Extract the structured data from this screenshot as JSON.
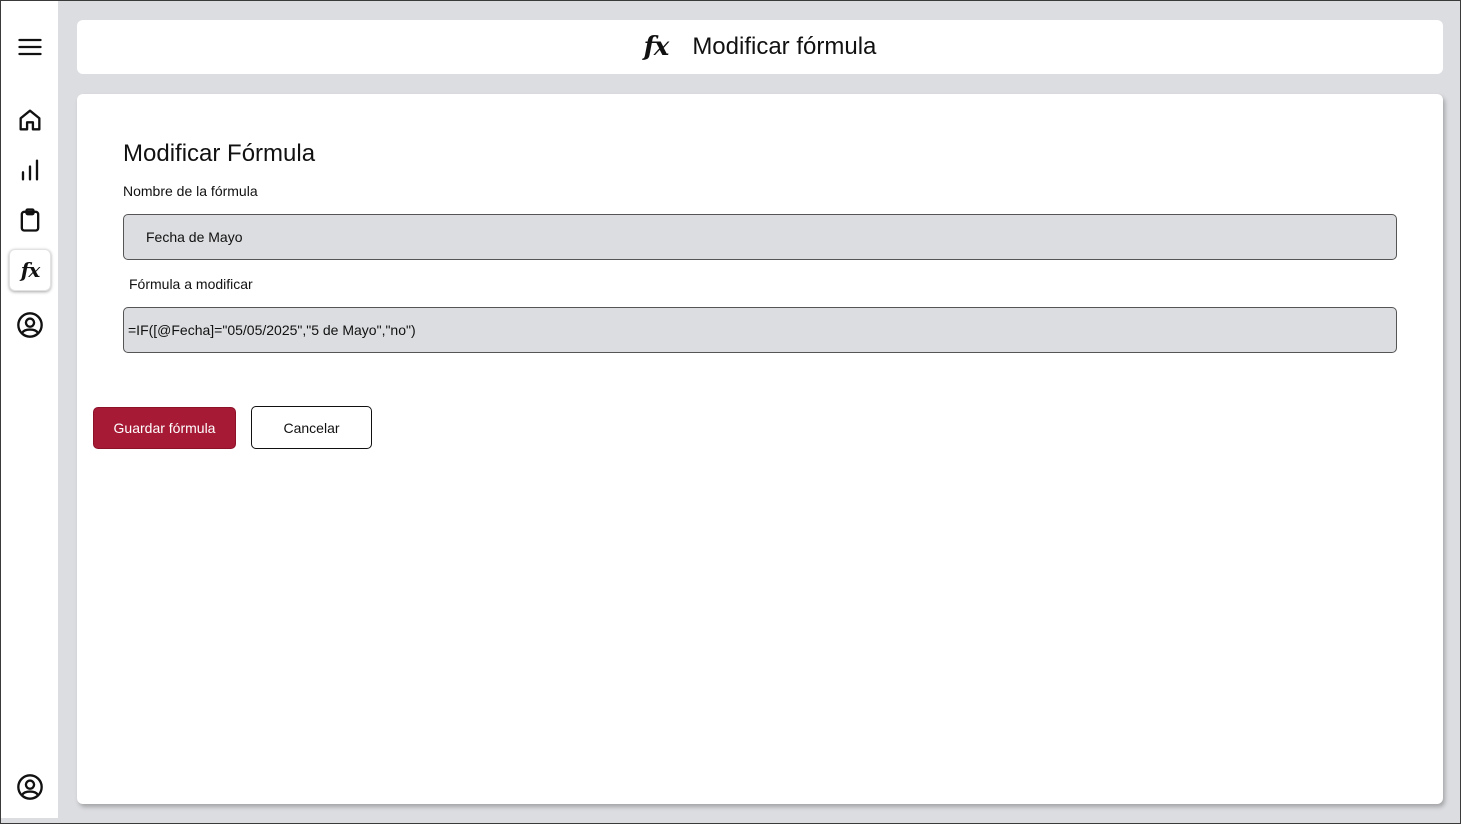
{
  "sidebar": {
    "items": [
      {
        "icon": "menu-icon"
      },
      {
        "icon": "home-icon"
      },
      {
        "icon": "bar-chart-icon"
      },
      {
        "icon": "clipboard-icon"
      },
      {
        "icon": "fx-icon",
        "glyph": "fx",
        "active": true
      },
      {
        "icon": "user-circle-icon"
      },
      {
        "icon": "profile-icon"
      }
    ]
  },
  "header": {
    "icon_glyph": "fx",
    "title": "Modificar fórmula"
  },
  "form": {
    "title": "Modificar Fórmula",
    "name_label": "Nombre de la fórmula",
    "name_value": "Fecha de Mayo",
    "formula_label": "Fórmula a modificar",
    "formula_value": "=IF([@Fecha]=\"05/05/2025\",\"5 de Mayo\",\"no\")",
    "save_label": "Guardar fórmula",
    "cancel_label": "Cancelar"
  },
  "colors": {
    "accent": "#a61a35",
    "background": "#dcdde0",
    "field_bg": "#dcdde0"
  }
}
